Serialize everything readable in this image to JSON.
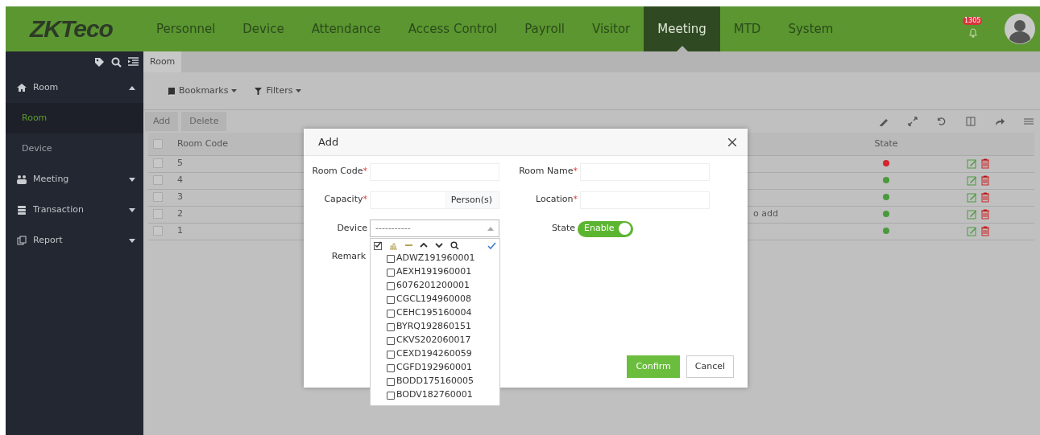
{
  "header": {
    "logo": "ZKTeco",
    "nav": [
      {
        "label": "Personnel",
        "selected": false
      },
      {
        "label": "Device",
        "selected": false
      },
      {
        "label": "Attendance",
        "selected": false
      },
      {
        "label": "Access Control",
        "selected": false
      },
      {
        "label": "Payroll",
        "selected": false
      },
      {
        "label": "Visitor",
        "selected": false
      },
      {
        "label": "Meeting",
        "selected": true
      },
      {
        "label": "MTD",
        "selected": false
      },
      {
        "label": "System",
        "selected": false
      }
    ],
    "notification_count": "1305"
  },
  "sidebar": {
    "items": [
      {
        "label": "Room",
        "expanded": true,
        "children": [
          {
            "label": "Room",
            "selected": true
          },
          {
            "label": "Device",
            "selected": false
          }
        ]
      },
      {
        "label": "Meeting",
        "expanded": false
      },
      {
        "label": "Transaction",
        "expanded": false
      },
      {
        "label": "Report",
        "expanded": false
      }
    ]
  },
  "breadcrumb": "Room",
  "toolbar": {
    "menus": [
      {
        "label": "Bookmarks"
      },
      {
        "label": "Filters"
      }
    ],
    "buttons": [
      "Add",
      "Delete"
    ]
  },
  "table": {
    "columns": [
      "Room Code",
      "State"
    ],
    "all_checked": false,
    "rows": [
      {
        "code": "5",
        "checked": false,
        "enabled": false
      },
      {
        "code": "4",
        "checked": false,
        "enabled": true
      },
      {
        "code": "3",
        "checked": false,
        "enabled": true
      },
      {
        "code": "2",
        "checked": false,
        "remark": "o add",
        "enabled": true
      },
      {
        "code": "1",
        "checked": false,
        "enabled": true
      }
    ]
  },
  "dialog": {
    "title": "Add",
    "room_code": {
      "label": "Room Code",
      "required_mark": "*"
    },
    "room_name": {
      "label": "Room Name",
      "required_mark": "*"
    },
    "capacity": {
      "label": "Capacity",
      "required_mark": "*",
      "unit": "Person(s)"
    },
    "location": {
      "label": "Location",
      "required_mark": "*"
    },
    "device": {
      "label": "Device",
      "placeholder": "-----------",
      "expanded": true,
      "options": [
        {
          "label": "ADWZ191960001",
          "checked": false
        },
        {
          "label": "AEXH191960001",
          "checked": false
        },
        {
          "label": "6076201200001",
          "checked": false
        },
        {
          "label": "CGCL194960008",
          "checked": false
        },
        {
          "label": "CEHC195160004",
          "checked": false
        },
        {
          "label": "BYRQ192860151",
          "checked": false
        },
        {
          "label": "CKVS202060017",
          "checked": false
        },
        {
          "label": "CEXD194260059",
          "checked": false
        },
        {
          "label": "CGFD192960001",
          "checked": false
        },
        {
          "label": "BODD175160005",
          "checked": false
        },
        {
          "label": "BODV182760001",
          "checked": false
        }
      ]
    },
    "state": {
      "label": "State",
      "on": true,
      "on_text": "Enable"
    },
    "remark": {
      "label": "Remark"
    },
    "buttons": [
      {
        "label": "Confirm",
        "kind": "primary"
      },
      {
        "label": "Cancel",
        "kind": "secondary"
      }
    ]
  }
}
